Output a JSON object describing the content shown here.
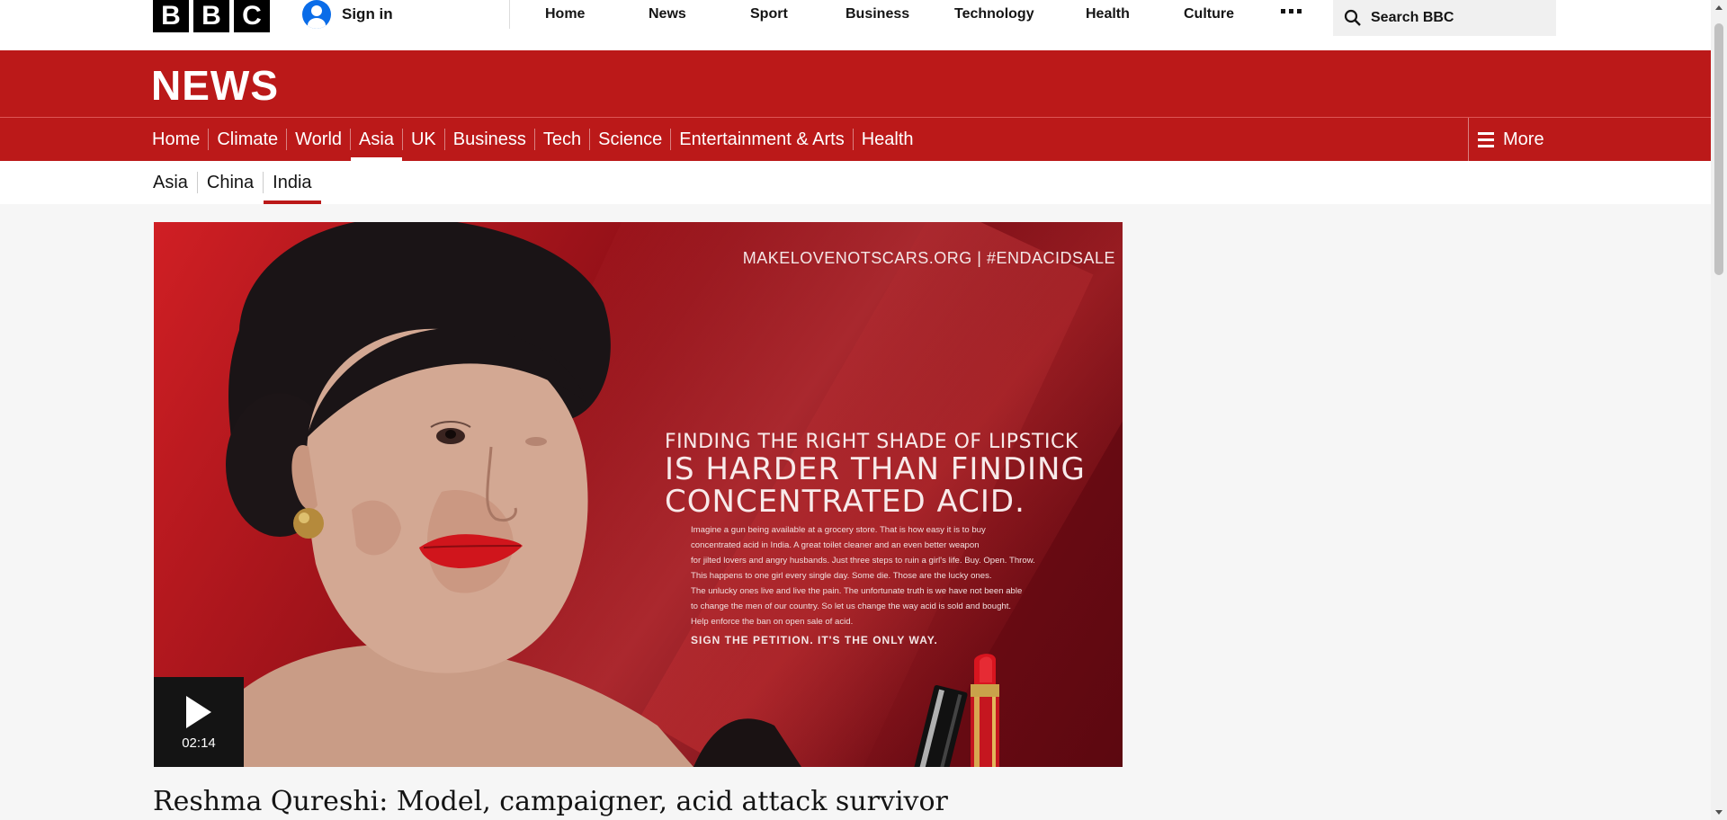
{
  "global_nav": {
    "logo_letters": [
      "B",
      "B",
      "C"
    ],
    "sign_in": "Sign in",
    "items": [
      "Home",
      "News",
      "Sport",
      "Business",
      "Technology",
      "Health",
      "Culture"
    ],
    "search_placeholder": "Search BBC"
  },
  "news_header": {
    "title": "NEWS",
    "nav_items": [
      "Home",
      "Climate",
      "World",
      "Asia",
      "UK",
      "Business",
      "Tech",
      "Science",
      "Entertainment & Arts",
      "Health"
    ],
    "active_nav": "Asia",
    "more_label": "More"
  },
  "sub_nav": {
    "items": [
      "Asia",
      "China",
      "India"
    ],
    "active": "India"
  },
  "video": {
    "duration": "02:14",
    "ad": {
      "url_text": "MAKELOVENOTSCARS.ORG | #ENDACIDSALE",
      "headline_line1": "FINDING THE RIGHT SHADE OF LIPSTICK",
      "headline_line2": "IS HARDER THAN FINDING",
      "headline_line3": "CONCENTRATED ACID.",
      "body_lines": [
        "Imagine a gun being available at a grocery store. That is how easy it is to buy",
        "concentrated acid in India. A great toilet cleaner and an even better weapon",
        "for jilted lovers and angry husbands. Just three steps to ruin a girl's life. Buy. Open. Throw.",
        "This happens to one girl every single day. Some die. Those are the lucky ones.",
        "The unlucky ones live and live the pain. The unfortunate truth is we have not been able",
        "to change the men of our country. So let us change the way acid is sold and bought.",
        "Help enforce the ban on open sale of acid."
      ],
      "cta": "SIGN THE PETITION. IT'S THE ONLY WAY."
    }
  },
  "article": {
    "headline": "Reshma Qureshi: Model, campaigner, acid attack survivor"
  },
  "colors": {
    "brand_red": "#bb1919",
    "sign_in_blue": "#0a6ce8"
  }
}
